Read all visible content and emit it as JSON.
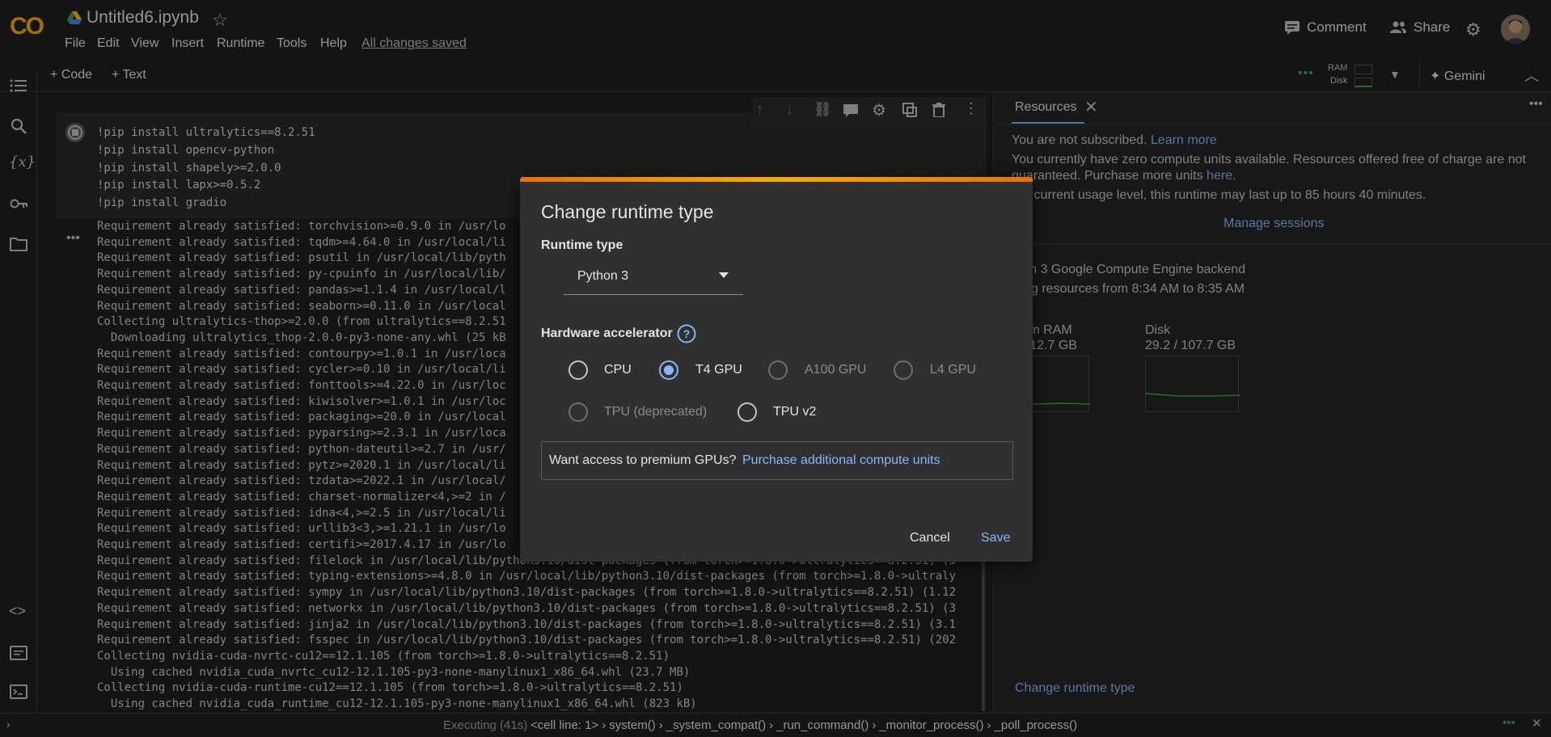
{
  "header": {
    "logo": "CO",
    "title": "Untitled6.ipynb",
    "menu": [
      "File",
      "Edit",
      "View",
      "Insert",
      "Runtime",
      "Tools",
      "Help"
    ],
    "saved_status": "All changes saved",
    "comment_label": "Comment",
    "share_label": "Share"
  },
  "toolbar": {
    "add_code": "+ Code",
    "add_text": "+ Text",
    "ram_label": "RAM",
    "disk_label": "Disk",
    "gemini_label": "✦ Gemini"
  },
  "cell": {
    "code": [
      "!pip install ultralytics==8.2.51",
      "!pip install opencv-python",
      "!pip install shapely>=2.0.0",
      "!pip install lapx>=0.5.2",
      "!pip install gradio"
    ],
    "output": [
      "Requirement already satisfied: torchvision>=0.9.0 in /usr/lo",
      "Requirement already satisfied: tqdm>=4.64.0 in /usr/local/li",
      "Requirement already satisfied: psutil in /usr/local/lib/pyth",
      "Requirement already satisfied: py-cpuinfo in /usr/local/lib/",
      "Requirement already satisfied: pandas>=1.1.4 in /usr/local/l",
      "Requirement already satisfied: seaborn>=0.11.0 in /usr/local",
      "Collecting ultralytics-thop>=2.0.0 (from ultralytics==8.2.51",
      "  Downloading ultralytics_thop-2.0.0-py3-none-any.whl (25 kB",
      "Requirement already satisfied: contourpy>=1.0.1 in /usr/loca",
      "Requirement already satisfied: cycler>=0.10 in /usr/local/li",
      "Requirement already satisfied: fonttools>=4.22.0 in /usr/loc",
      "Requirement already satisfied: kiwisolver>=1.0.1 in /usr/loc",
      "Requirement already satisfied: packaging>=20.0 in /usr/local",
      "Requirement already satisfied: pyparsing>=2.3.1 in /usr/loca",
      "Requirement already satisfied: python-dateutil>=2.7 in /usr/",
      "Requirement already satisfied: pytz>=2020.1 in /usr/local/li",
      "Requirement already satisfied: tzdata>=2022.1 in /usr/local/",
      "Requirement already satisfied: charset-normalizer<4,>=2 in /",
      "Requirement already satisfied: idna<4,>=2.5 in /usr/local/li",
      "Requirement already satisfied: urllib3<3,>=1.21.1 in /usr/lo",
      "Requirement already satisfied: certifi>=2017.4.17 in /usr/lo",
      "Requirement already satisfied: filelock in /usr/local/lib/python3.10/dist-packages (from torch>=1.8.0->ultralytics==8.2.51) (3",
      "Requirement already satisfied: typing-extensions>=4.8.0 in /usr/local/lib/python3.10/dist-packages (from torch>=1.8.0->ultraly",
      "Requirement already satisfied: sympy in /usr/local/lib/python3.10/dist-packages (from torch>=1.8.0->ultralytics==8.2.51) (1.12",
      "Requirement already satisfied: networkx in /usr/local/lib/python3.10/dist-packages (from torch>=1.8.0->ultralytics==8.2.51) (3",
      "Requirement already satisfied: jinja2 in /usr/local/lib/python3.10/dist-packages (from torch>=1.8.0->ultralytics==8.2.51) (3.1",
      "Requirement already satisfied: fsspec in /usr/local/lib/python3.10/dist-packages (from torch>=1.8.0->ultralytics==8.2.51) (202",
      "Collecting nvidia-cuda-nvrtc-cu12==12.1.105 (from torch>=1.8.0->ultralytics==8.2.51)",
      "  Using cached nvidia_cuda_nvrtc_cu12-12.1.105-py3-none-manylinux1_x86_64.whl (23.7 MB)",
      "Collecting nvidia-cuda-runtime-cu12==12.1.105 (from torch>=1.8.0->ultralytics==8.2.51)",
      "  Using cached nvidia_cuda_runtime_cu12-12.1.105-py3-none-manylinux1_x86_64.whl (823 kB)"
    ]
  },
  "resources": {
    "tab_label": "Resources",
    "not_subscribed": "You are not subscribed.",
    "learn_more": "Learn more",
    "zero_units_1": "You currently have zero compute units available. Resources offered free of charge are not",
    "zero_units_2": "guaranteed. Purchase more units",
    "here": "here",
    "usage_level": "our current usage level, this runtime may last up to 85 hours 40 minutes.",
    "manage_sessions": "Manage sessions",
    "backend": "thon 3 Google Compute Engine backend",
    "showing": "wing resources from 8:34 AM to 8:35 AM",
    "system_ram_label": "stem RAM",
    "system_ram_value": "2 / 12.7 GB",
    "disk_label": "Disk",
    "disk_value": "29.2 / 107.7 GB",
    "change_runtime": "Change runtime type"
  },
  "dialog": {
    "title": "Change runtime type",
    "runtime_type_label": "Runtime type",
    "runtime_selected": "Python 3",
    "hw_label": "Hardware accelerator",
    "options": [
      {
        "label": "CPU",
        "checked": false,
        "disabled": false
      },
      {
        "label": "T4 GPU",
        "checked": true,
        "disabled": false
      },
      {
        "label": "A100 GPU",
        "checked": false,
        "disabled": true
      },
      {
        "label": "L4 GPU",
        "checked": false,
        "disabled": true
      },
      {
        "label": "TPU (deprecated)",
        "checked": false,
        "disabled": true
      },
      {
        "label": "TPU v2",
        "checked": false,
        "disabled": false
      }
    ],
    "premium_text": "Want access to premium GPUs?",
    "premium_link": "Purchase additional compute units",
    "cancel": "Cancel",
    "save": "Save"
  },
  "status_bar": {
    "executing": "Executing (41s)",
    "trace": [
      "<cell line: 1>",
      "system()",
      "_system_compat()",
      "_run_command()",
      "_monitor_process()",
      "_poll_process()"
    ]
  },
  "colors": {
    "accent": "#8ab4f8",
    "logo": "#f9ab00",
    "modal_bar": "#f9ab00"
  }
}
